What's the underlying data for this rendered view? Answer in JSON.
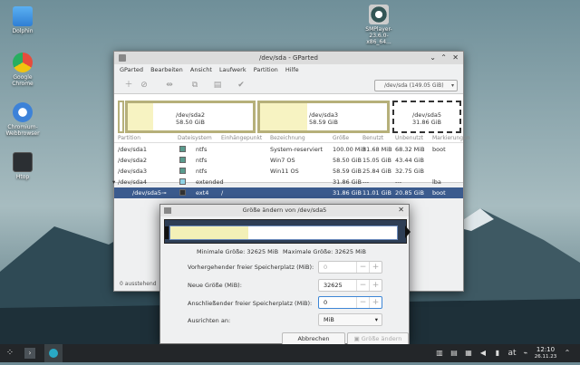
{
  "desktop": {
    "icons": [
      {
        "label": "Dolphin",
        "icon": "folder-icon"
      },
      {
        "label": "Google Chrome",
        "icon": "chrome-icon"
      },
      {
        "label": "Chromium-Webbrowser",
        "icon": "chromium-icon"
      },
      {
        "label": "Htop",
        "icon": "htop-icon"
      },
      {
        "label": "SMPlayer-23.6.0-x86_64...",
        "icon": "smplayer-icon"
      }
    ]
  },
  "gparted": {
    "title": "/dev/sda - GParted",
    "menu": [
      "GParted",
      "Bearbeiten",
      "Ansicht",
      "Laufwerk",
      "Partition",
      "Hilfe"
    ],
    "device_selector": "/dev/sda (149.05 GiB)",
    "visual": [
      {
        "name": "/dev/sda2",
        "size": "58.50 GiB"
      },
      {
        "name": "/dev/sda3",
        "size": "58.59 GiB"
      },
      {
        "name": "/dev/sda5",
        "size": "31.86 GiB"
      }
    ],
    "columns": [
      "Partition",
      "Dateisystem",
      "Einhängepunkt",
      "Bezeichnung",
      "Größe",
      "Benutzt",
      "Unbenutzt",
      "Markierungen"
    ],
    "rows": [
      {
        "partition": "/dev/sda1",
        "fs": "ntfs",
        "mount": "",
        "label": "System-reserviert",
        "size": "100.00 MiB",
        "used": "31.68 MiB",
        "unused": "68.32 MiB",
        "flags": "boot",
        "color": "#5a9c8e"
      },
      {
        "partition": "/dev/sda2",
        "fs": "ntfs",
        "mount": "",
        "label": "Win7 OS",
        "size": "58.50 GiB",
        "used": "15.05 GiB",
        "unused": "43.44 GiB",
        "flags": "",
        "color": "#5a9c8e"
      },
      {
        "partition": "/dev/sda3",
        "fs": "ntfs",
        "mount": "",
        "label": "Win11 OS",
        "size": "58.59 GiB",
        "used": "25.84 GiB",
        "unused": "32.75 GiB",
        "flags": "",
        "color": "#5a9c8e"
      },
      {
        "partition": "/dev/sda4",
        "fs": "extended",
        "mount": "",
        "label": "",
        "size": "31.86 GiB",
        "used": "---",
        "unused": "---",
        "flags": "lba",
        "color": "#8fd3e6"
      },
      {
        "partition": "/dev/sda5",
        "fs": "ext4",
        "mount": "/",
        "label": "",
        "size": "31.86 GiB",
        "used": "11.01 GiB",
        "unused": "20.85 GiB",
        "flags": "boot",
        "color": "#333333"
      }
    ],
    "status": "0 ausstehend"
  },
  "dialog": {
    "title": "Größe ändern von /dev/sda5",
    "min_size": "Minimale Größe: 32625 MiB",
    "max_size": "Maximale Größe: 32625 MiB",
    "fields": [
      {
        "label": "Vorhergehender freier Speicherplatz (MiB):",
        "value": "0"
      },
      {
        "label": "Neue Größe (MiB):",
        "value": "32625"
      },
      {
        "label": "Anschließender freier Speicherplatz (MiB):",
        "value": "0"
      }
    ],
    "align_label": "Ausrichten an:",
    "align_value": "MiB",
    "cancel": "Abbrechen",
    "resize": "Größe ändern"
  },
  "taskbar": {
    "keyboard": "at",
    "time": "12:10",
    "date": "26.11.23"
  }
}
